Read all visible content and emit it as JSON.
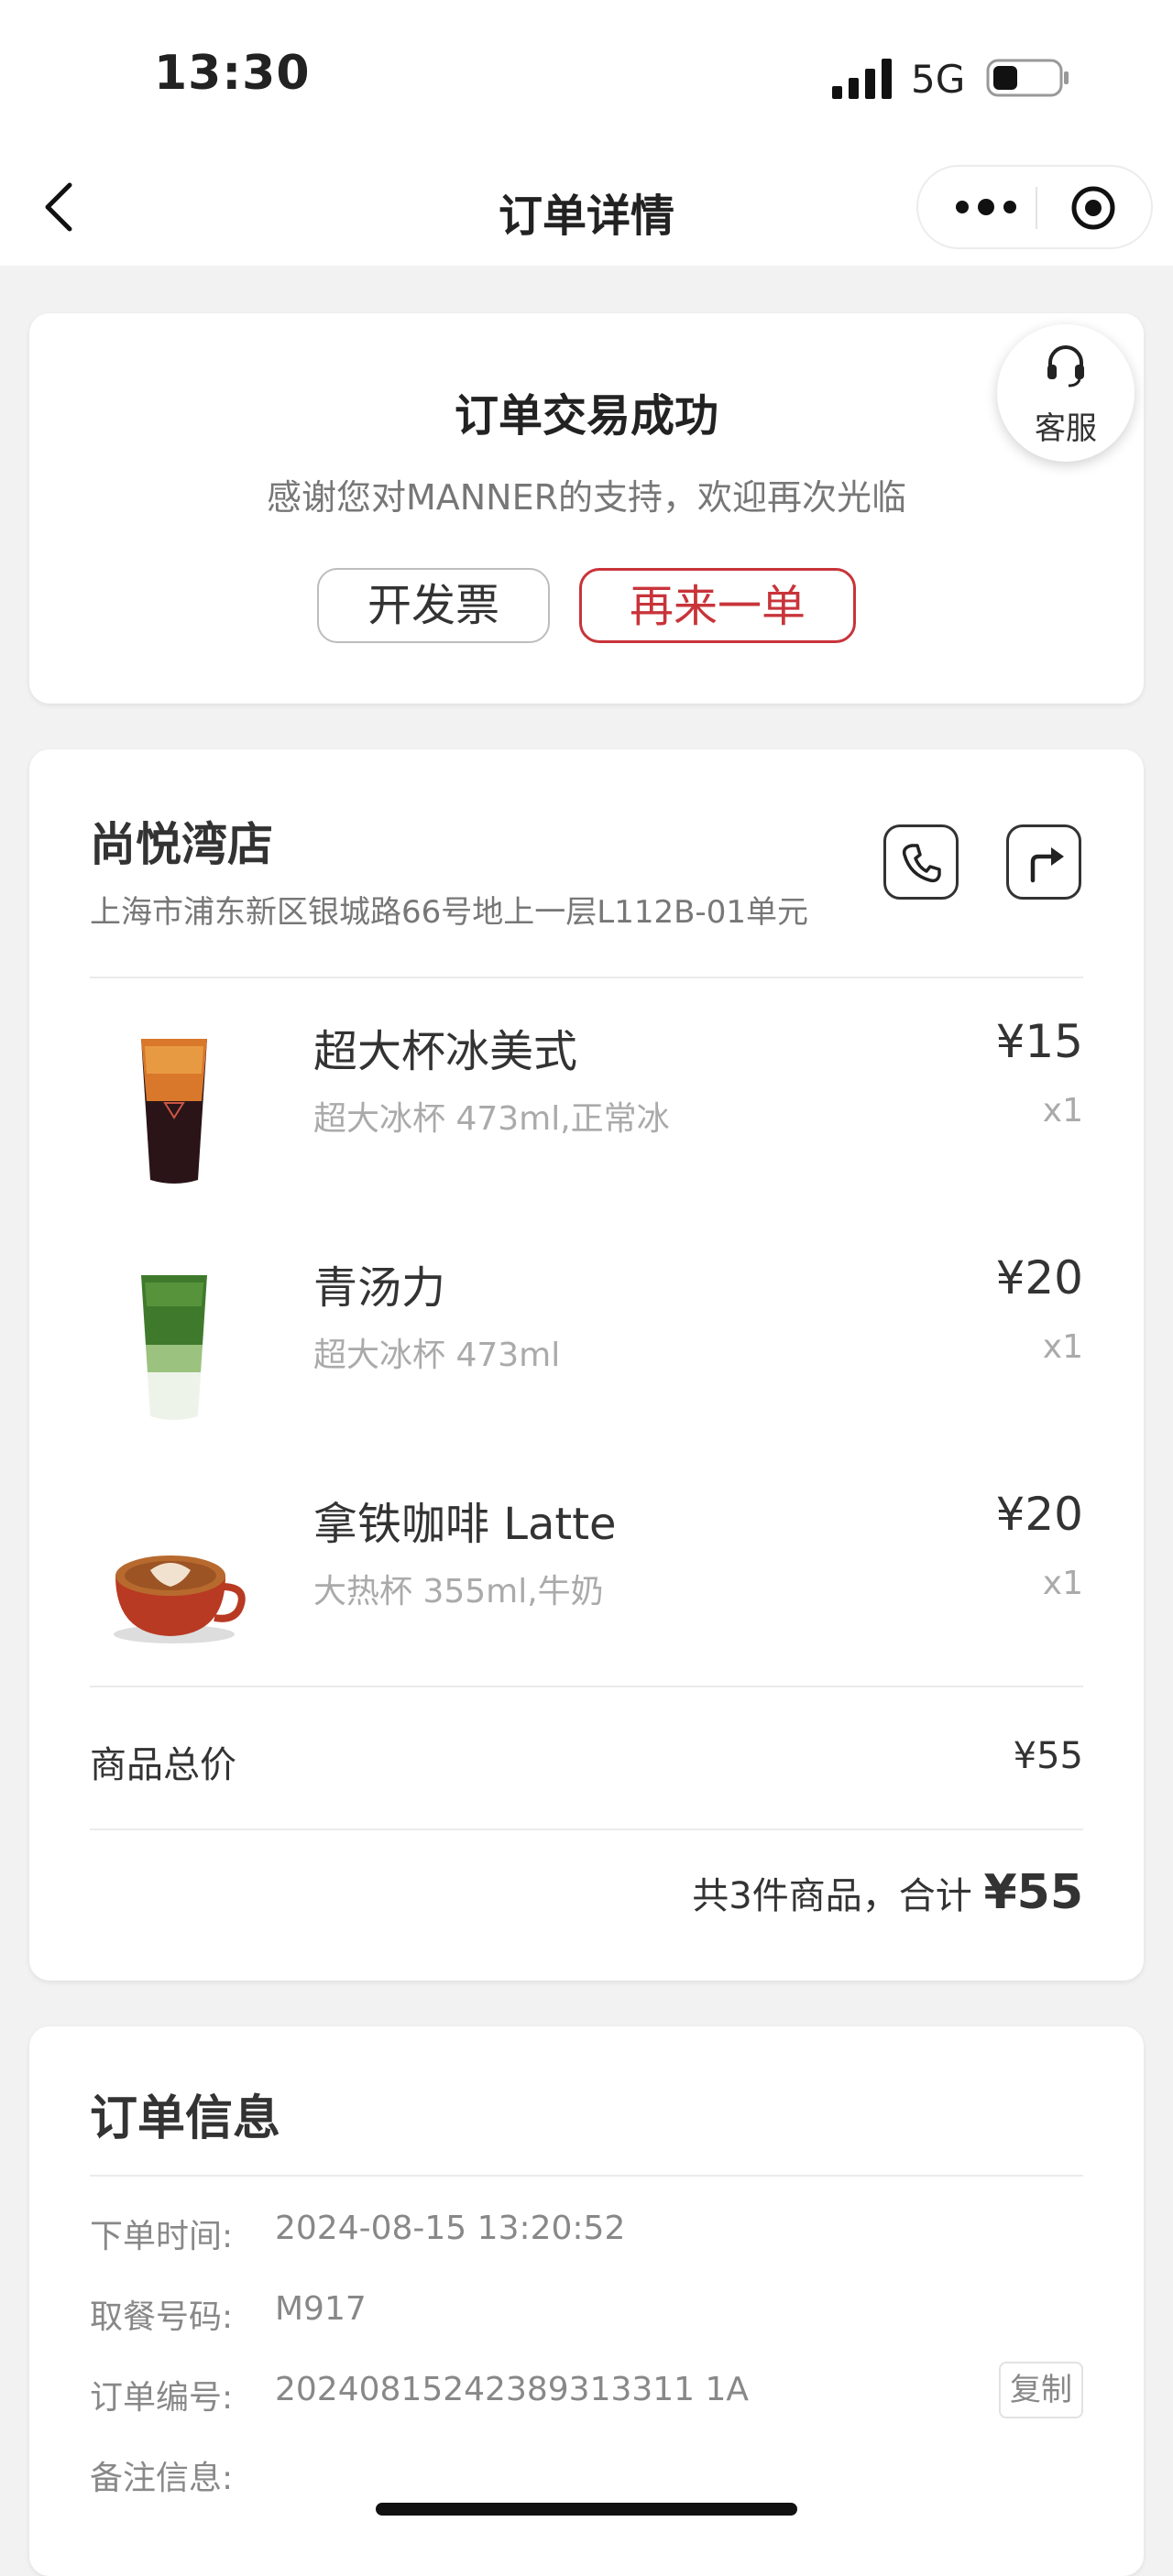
{
  "status": {
    "time": "13:30",
    "network": "5G"
  },
  "nav": {
    "title": "订单详情"
  },
  "success": {
    "title": "订单交易成功",
    "subtitle": "感谢您对MANNER的支持，欢迎再次光临",
    "invoice_label": "开发票",
    "reorder_label": "再来一单",
    "customer_service": "客服"
  },
  "store": {
    "name": "尚悦湾店",
    "address": "上海市浦东新区银城路66号地上一层L112B-01单元"
  },
  "items": [
    {
      "name": "超大杯冰美式",
      "spec": "超大冰杯 473ml,正常冰",
      "price": "¥15",
      "qty": "x1",
      "image": "iced-americano"
    },
    {
      "name": "青汤力",
      "spec": "超大冰杯 473ml",
      "price": "¥20",
      "qty": "x1",
      "image": "matcha-tonic"
    },
    {
      "name": "拿铁咖啡 Latte",
      "spec": "大热杯 355ml,牛奶",
      "price": "¥20",
      "qty": "x1",
      "image": "latte"
    }
  ],
  "totals": {
    "goods_label": "商品总价",
    "goods_value": "¥55",
    "summary_prefix": "共3件商品，合计",
    "summary_amount": "¥55"
  },
  "order_info": {
    "title": "订单信息",
    "rows": [
      {
        "label": "下单时间:",
        "value": "2024-08-15 13:20:52"
      },
      {
        "label": "取餐号码:",
        "value": "M917"
      },
      {
        "label": "订单编号:",
        "value": "20240815242389313311 1A"
      },
      {
        "label": "备注信息:",
        "value": ""
      }
    ],
    "copy_label": "复制"
  },
  "colors": {
    "accent": "#c8343a",
    "background": "#f2f2f2"
  },
  "icons": [
    "back-icon",
    "more-icon",
    "target-icon",
    "headset-icon",
    "phone-icon",
    "directions-icon",
    "signal-icon",
    "battery-icon"
  ]
}
